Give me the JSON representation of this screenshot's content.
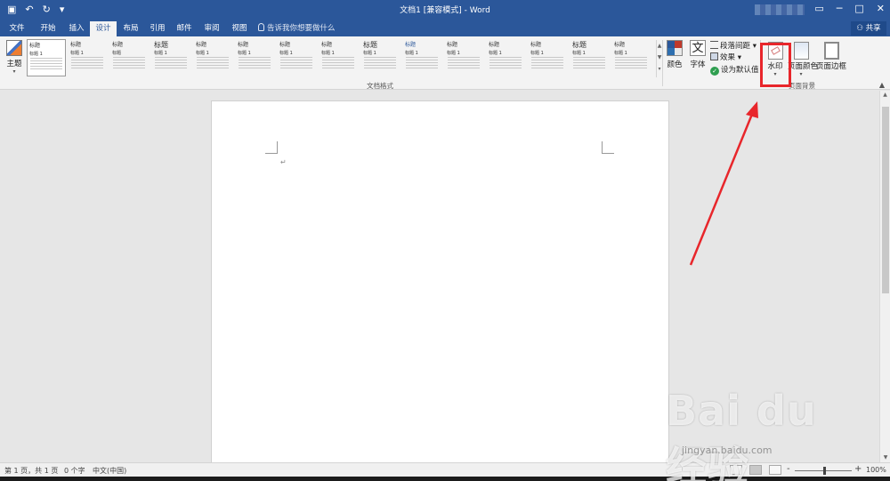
{
  "titlebar": {
    "title": "文档1 [兼容模式] - Word",
    "qa_icons": [
      "save-icon",
      "undo-icon",
      "redo-icon",
      "customize-icon"
    ],
    "window_icons": [
      "ribbon-display-icon",
      "minimize-icon",
      "maximize-icon",
      "close-icon"
    ]
  },
  "tabs": [
    {
      "label": "文件",
      "active": false
    },
    {
      "label": "开始",
      "active": false
    },
    {
      "label": "插入",
      "active": false
    },
    {
      "label": "设计",
      "active": true
    },
    {
      "label": "布局",
      "active": false
    },
    {
      "label": "引用",
      "active": false
    },
    {
      "label": "邮件",
      "active": false
    },
    {
      "label": "审阅",
      "active": false
    },
    {
      "label": "视图",
      "active": false
    }
  ],
  "tell_me": "告诉我你想要做什么",
  "share_label": "共享",
  "ribbon": {
    "theme_label": "主题",
    "styles_group_label": "文档格式",
    "style_sets": [
      {
        "title": "标题",
        "heading": "标题 1"
      },
      {
        "title": "标题",
        "heading": "标题 1"
      },
      {
        "title": "标题",
        "heading": "标题"
      },
      {
        "title": "标题",
        "heading": "标题 1"
      },
      {
        "title": "标题",
        "heading": "标题 1"
      },
      {
        "title": "标题",
        "heading": "标题 1"
      },
      {
        "title": "标题",
        "heading": "标题 1"
      },
      {
        "title": "标题",
        "heading": "标题 1"
      },
      {
        "title": "标题",
        "heading": "标题 1"
      },
      {
        "title": "标题",
        "heading": "标题 1"
      },
      {
        "title": "标题",
        "heading": "标题 1"
      },
      {
        "title": "标题",
        "heading": "标题 1"
      },
      {
        "title": "标题",
        "heading": "标题 1"
      },
      {
        "title": "标题",
        "heading": "标题 1"
      },
      {
        "title": "标题",
        "heading": "标题 1"
      }
    ],
    "colors_label": "颜色",
    "fonts_label": "字体",
    "paragraph_spacing_label": "段落间距",
    "effects_label": "效果",
    "set_default_label": "设为默认值",
    "watermark_label": "水印",
    "page_color_label": "页面颜色",
    "page_borders_label": "页面边框",
    "page_background_group_label": "页面背景"
  },
  "document": {
    "paragraph_mark": "↵"
  },
  "statusbar": {
    "page_info": "第 1 页，共 1 页",
    "word_count": "0 个字",
    "language": "中文(中国)",
    "zoom_minus": "-",
    "zoom_plus": "+",
    "zoom_percent": "100%"
  },
  "watermark": {
    "logo_text": "Bai du 经验",
    "url": "jingyan.baidu.com"
  },
  "colors": {
    "word_blue": "#2b579a",
    "highlight_red": "#e8262b"
  }
}
